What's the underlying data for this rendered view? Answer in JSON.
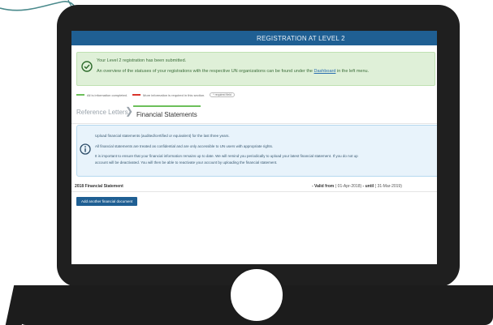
{
  "header": {
    "title": "REGISTRATION AT LEVEL 2"
  },
  "success": {
    "line1": "Your Level 2 registration has been submitted.",
    "line2_pre": "An overview of the statuses of your registrations with the respective UN organizations can be found under the",
    "line2_link": "Dashboard",
    "line2_post": "in the left menu."
  },
  "legend": {
    "completed": "All is information completed.",
    "required": "More information is required in this section.",
    "required_field": "* required field"
  },
  "tabs": [
    {
      "label": "Reference Letters"
    },
    {
      "label": "Financial Statements"
    }
  ],
  "info": {
    "line1": "Upload financial statements (audited/certified or equivalent) for the last three years.",
    "line2": "All financial statements are treated as confidential and are only accessible to UN users with appropriate rights.",
    "line3": "It is important to ensure that your financial information remains up to date. We will remind you periodically to upload your latest financial statement. If you do not up",
    "line4": "account will be deactivated. You will then be able to reactivate your account by uploading the financial statement."
  },
  "statement": {
    "title": "2018 Financial Statement",
    "valid_prefix": "- Valid from",
    "valid_from": "( 01-Apr-2018)",
    "until_label": "- until",
    "valid_until": "( 31-Mar-2019)"
  },
  "actions": {
    "add_document": "Add another financial document"
  },
  "colors": {
    "accent": "#1f5f93",
    "success_bg": "#dff0d8",
    "info_bg": "#e8f3fb",
    "completed": "#6cbf5a",
    "required": "#d9342b"
  },
  "icons": [
    "check-circle-icon",
    "info-circle-icon",
    "chevron-right-icon"
  ]
}
